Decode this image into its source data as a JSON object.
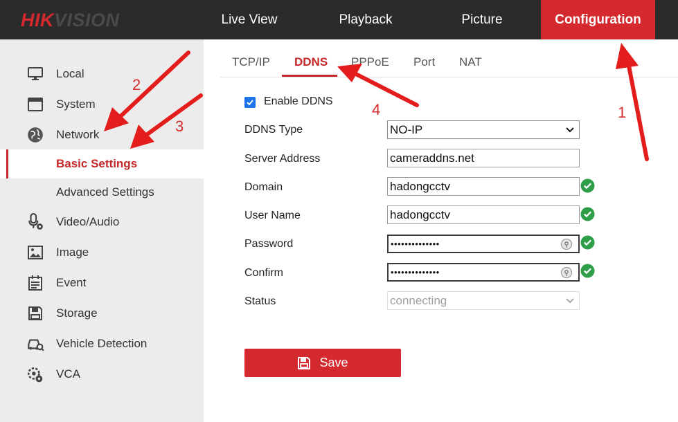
{
  "brand": {
    "logo_hik": "HIK",
    "logo_vision": "VISION"
  },
  "nav": {
    "items": [
      {
        "label": "Live View"
      },
      {
        "label": "Playback"
      },
      {
        "label": "Picture"
      },
      {
        "label": "Configuration",
        "active": true
      }
    ]
  },
  "sidebar": {
    "items": [
      {
        "label": "Local",
        "icon": "monitor-icon"
      },
      {
        "label": "System",
        "icon": "window-icon"
      },
      {
        "label": "Network",
        "icon": "globe-icon"
      },
      {
        "label": "Basic Settings",
        "selected": true
      },
      {
        "label": "Advanced Settings"
      },
      {
        "label": "Video/Audio",
        "icon": "microphone-icon"
      },
      {
        "label": "Image",
        "icon": "image-icon"
      },
      {
        "label": "Event",
        "icon": "calendar-icon"
      },
      {
        "label": "Storage",
        "icon": "save-disk-icon"
      },
      {
        "label": "Vehicle Detection",
        "icon": "vehicle-search-icon"
      },
      {
        "label": "VCA",
        "icon": "vca-gear-icon"
      }
    ]
  },
  "tabs": [
    {
      "label": "TCP/IP"
    },
    {
      "label": "DDNS",
      "active": true
    },
    {
      "label": "PPPoE"
    },
    {
      "label": "Port"
    },
    {
      "label": "NAT"
    }
  ],
  "form": {
    "enable_label": "Enable DDNS",
    "enable_checked": true,
    "ddns_type_label": "DDNS Type",
    "ddns_type_value": "NO-IP",
    "server_label": "Server Address",
    "server_value": "cameraddns.net",
    "domain_label": "Domain",
    "domain_value": "hadongcctv",
    "user_label": "User Name",
    "user_value": "hadongcctv",
    "password_label": "Password",
    "password_value": "••••••••••••••",
    "confirm_label": "Confirm",
    "confirm_value": "••••••••••••••",
    "status_label": "Status",
    "status_value": "connecting",
    "save_label": "Save"
  },
  "annotations": {
    "step1": "1",
    "step2": "2",
    "step3": "3",
    "step4": "4"
  },
  "colors": {
    "brand_red": "#d3292f",
    "topbar": "#2b2b2b",
    "sidebar_bg": "#ececec",
    "valid_green": "#2e9e48",
    "annotation_red": "#e31c1c"
  }
}
